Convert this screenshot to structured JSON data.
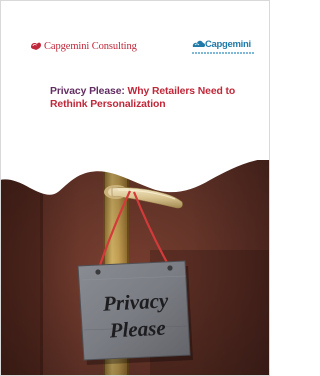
{
  "cover": {
    "brand_left": "Capgemini Consulting",
    "brand_right": "Capgemini",
    "title_part1": "Privacy Please: ",
    "title_part2": "Why Retailers Need to Rethink Personalization",
    "sign_line1": "Privacy",
    "sign_line2": "Please"
  },
  "colors": {
    "brand_red": "#c0283a",
    "title_purple": "#612d62",
    "brand_blue": "#1f7aa8",
    "door_brown": "#6e3a2e"
  },
  "icons": {
    "left_logo": "spade-logo-icon",
    "right_logo": "cloud-logo-icon"
  }
}
